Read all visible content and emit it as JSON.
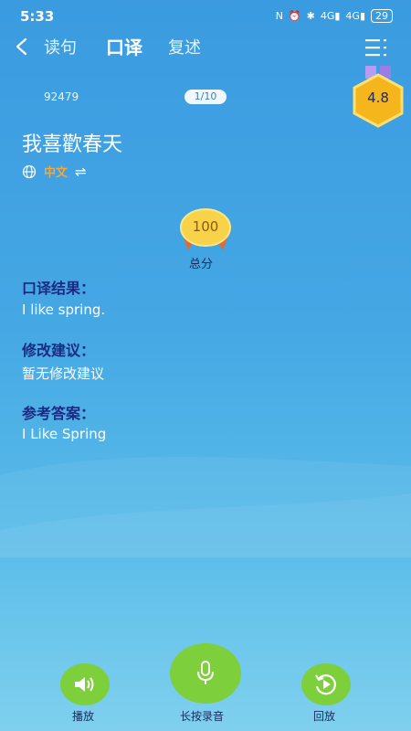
{
  "status": {
    "time": "5:33",
    "battery": "29"
  },
  "nav": {
    "tabs": [
      "读句",
      "口译",
      "复述"
    ]
  },
  "header": {
    "id_text": "92479",
    "page": "1/10",
    "rating": "4.8"
  },
  "sentence": {
    "text": "我喜歡春天",
    "language": "中文"
  },
  "score": {
    "value": "100",
    "label": "总分"
  },
  "sections": [
    {
      "title": "口译结果：",
      "body": "I like spring."
    },
    {
      "title": "修改建议：",
      "body": "暂无修改建议"
    },
    {
      "title": "参考答案：",
      "body": "I Like Spring"
    }
  ],
  "controls": {
    "play_label": "播放",
    "record_label": "长按录音",
    "replay_label": "回放"
  },
  "colors": {
    "accent_green": "#7dcf3c",
    "title_blue": "#1b2a82",
    "medal_gold": "#f5b51d",
    "lang_orange": "#f7a73a"
  }
}
